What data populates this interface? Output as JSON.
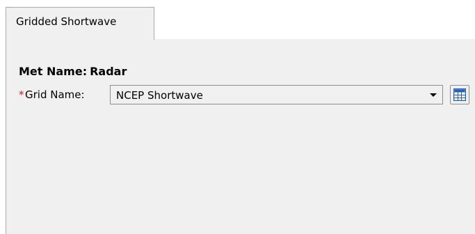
{
  "tabs": [
    {
      "label": "Gridded Shortwave",
      "active": true
    }
  ],
  "met": {
    "label": "Met Name:",
    "value": "Radar"
  },
  "grid": {
    "required_marker": "*",
    "label": "Grid Name:",
    "selected": "NCEP Shortwave",
    "button_icon": "grid-table-icon"
  },
  "colors": {
    "panel_bg": "#f0f0f0",
    "required": "#d21e1e",
    "icon_blue": "#1f5fbf"
  }
}
